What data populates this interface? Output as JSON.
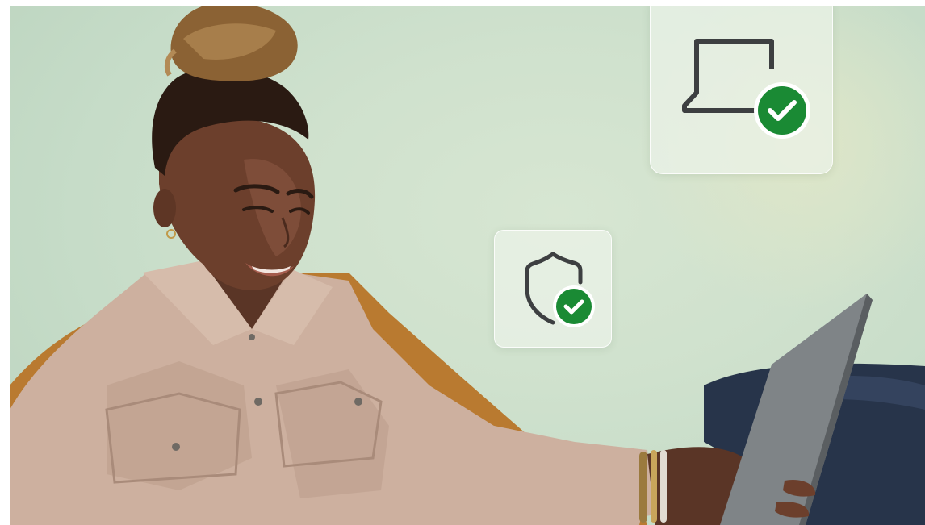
{
  "scene": {
    "description_colors": {
      "background": "#cfe1cd",
      "shirt": "#cdb09e",
      "jacket_accent": "#b8792e",
      "skin": "#6a3f2c",
      "tablet": "#808486",
      "check_green": "#1a8a34",
      "icon_stroke": "#3d3f41"
    }
  },
  "cards": {
    "laptop_card": {
      "icon": "laptop-icon",
      "badge": "check-circle-icon"
    },
    "shield_card": {
      "icon": "shield-icon",
      "badge": "check-circle-icon"
    }
  }
}
